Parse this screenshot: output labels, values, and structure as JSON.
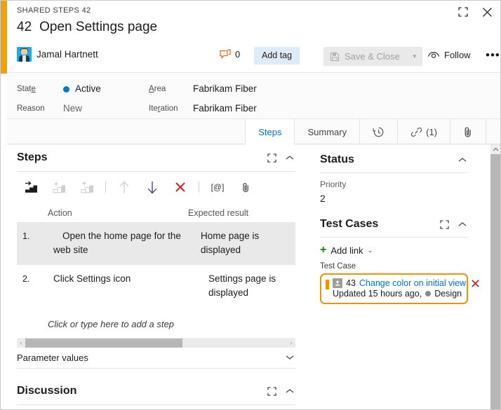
{
  "window": {
    "breadcrumb": "SHARED STEPS 42",
    "maximize_icon": "maximize-icon",
    "close_icon": "close-icon",
    "accent_color": "#f2a104"
  },
  "header": {
    "work_item_id": "42",
    "title": "Open Settings page",
    "assignee": "Jamal Hartnett",
    "avatar_icon": "avatar",
    "comment_icon": "comment-icon",
    "comment_count": "0",
    "add_tag_label": "Add tag",
    "save_close_label": "Save & Close",
    "save_close_icon": "save-icon",
    "save_close_caret": "▾",
    "follow_label": "Follow",
    "follow_icon": "eye-icon",
    "more_label": "•••"
  },
  "fields": {
    "state_label": "State",
    "state_label_accel": "e",
    "state_value": "Active",
    "state_color": "#007acc",
    "reason_label": "Reason",
    "reason_value": "New",
    "area_label_accel": "A",
    "area_label": "rea",
    "area_value": "Fabrikam Fiber",
    "iteration_label_pre": "Ite",
    "iteration_label_accel": "r",
    "iteration_label_post": "ation",
    "iteration_value": "Fabrikam Fiber"
  },
  "tabs": [
    {
      "label": "Steps",
      "icon": "",
      "count": "",
      "active": true
    },
    {
      "label": "Summary",
      "icon": "",
      "count": "",
      "active": false
    },
    {
      "label": "",
      "icon": "history-icon",
      "count": "",
      "active": false
    },
    {
      "label": "",
      "icon": "link-icon",
      "count": "(1)",
      "active": false
    },
    {
      "label": "",
      "icon": "attachment-icon",
      "count": "",
      "active": false
    }
  ],
  "steps_section": {
    "title": "Steps",
    "expand_icon": "expand-icon",
    "collapse_icon": "chevron-up-icon",
    "toolbar": [
      {
        "name": "insert-step-icon",
        "enabled": true
      },
      {
        "name": "insert-shared-steps-icon",
        "enabled": false
      },
      {
        "name": "create-shared-steps-icon",
        "enabled": false
      },
      {
        "name": "move-up-icon",
        "enabled": false
      },
      {
        "name": "move-down-icon",
        "enabled": true
      },
      {
        "name": "delete-step-icon",
        "enabled": true
      },
      {
        "name": "insert-parameter-icon",
        "enabled": true,
        "glyph": "[@]"
      },
      {
        "name": "attach-file-icon",
        "enabled": true
      }
    ],
    "columns": {
      "number": "",
      "action": "Action",
      "expected": "Expected result"
    },
    "rows": [
      {
        "num": "1.",
        "action": "Open the home page for the web site",
        "expected": "Home page is displayed",
        "selected": true
      },
      {
        "num": "2.",
        "action": "Click Settings icon",
        "expected": "Settings page is displayed",
        "selected": false
      }
    ],
    "add_step_hint": "Click or type here to add a step",
    "hscroll": {
      "left_arrow": "‹",
      "right_arrow": "›",
      "thumb_percent": 60
    }
  },
  "parameter_values": {
    "label": "Parameter values",
    "caret_icon": "chevron-down-icon"
  },
  "discussion": {
    "title": "Discussion",
    "expand_icon": "expand-icon",
    "collapse_icon": "chevron-up-icon"
  },
  "status_section": {
    "title": "Status",
    "collapse_icon": "chevron-up-icon",
    "priority_label": "Priority",
    "priority_value": "2"
  },
  "test_cases_section": {
    "title": "Test Cases",
    "expand_icon": "expand-icon",
    "collapse_icon": "chevron-up-icon",
    "add_link_label": "Add link",
    "add_link_caret": "⌄",
    "group_label": "Test Case",
    "card": {
      "id": "43",
      "link_text": "Change color on initial view",
      "icon": "test-case-icon",
      "remove_icon": "remove-link-icon",
      "meta_updated": "Updated 15 hours ago,",
      "meta_state": "Design",
      "state_dot_color": "#8a8a8a",
      "highlight_color": "#f29100"
    }
  },
  "scrollbar": {
    "up_arrow": "▲"
  }
}
